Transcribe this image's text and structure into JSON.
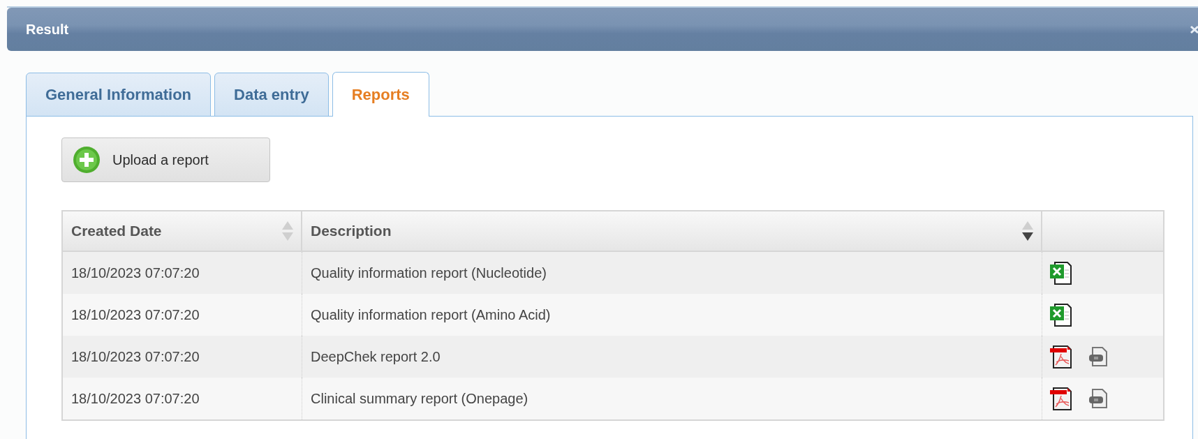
{
  "window": {
    "title": "Result"
  },
  "tabs": [
    {
      "label": "General Information",
      "selected": false
    },
    {
      "label": "Data entry",
      "selected": false
    },
    {
      "label": "Reports",
      "selected": true
    }
  ],
  "upload_button": {
    "label": "Upload a report"
  },
  "table": {
    "columns": [
      {
        "label": "Created Date",
        "sorted": false
      },
      {
        "label": "Description",
        "sorted": true
      }
    ],
    "rows": [
      {
        "created": "18/10/2023 07:07:20",
        "description": "Quality information report (Nucleotide)",
        "files": [
          {
            "kind": "excel"
          }
        ]
      },
      {
        "created": "18/10/2023 07:07:20",
        "description": "Quality information report (Amino Acid)",
        "files": [
          {
            "kind": "excel"
          }
        ]
      },
      {
        "created": "18/10/2023 07:07:20",
        "description": "DeepChek report 2.0",
        "files": [
          {
            "kind": "pdf"
          },
          {
            "kind": "sif"
          }
        ]
      },
      {
        "created": "18/10/2023 07:07:20",
        "description": "Clinical summary report (Onepage)",
        "files": [
          {
            "kind": "pdf"
          },
          {
            "kind": "sif"
          }
        ]
      }
    ]
  }
}
